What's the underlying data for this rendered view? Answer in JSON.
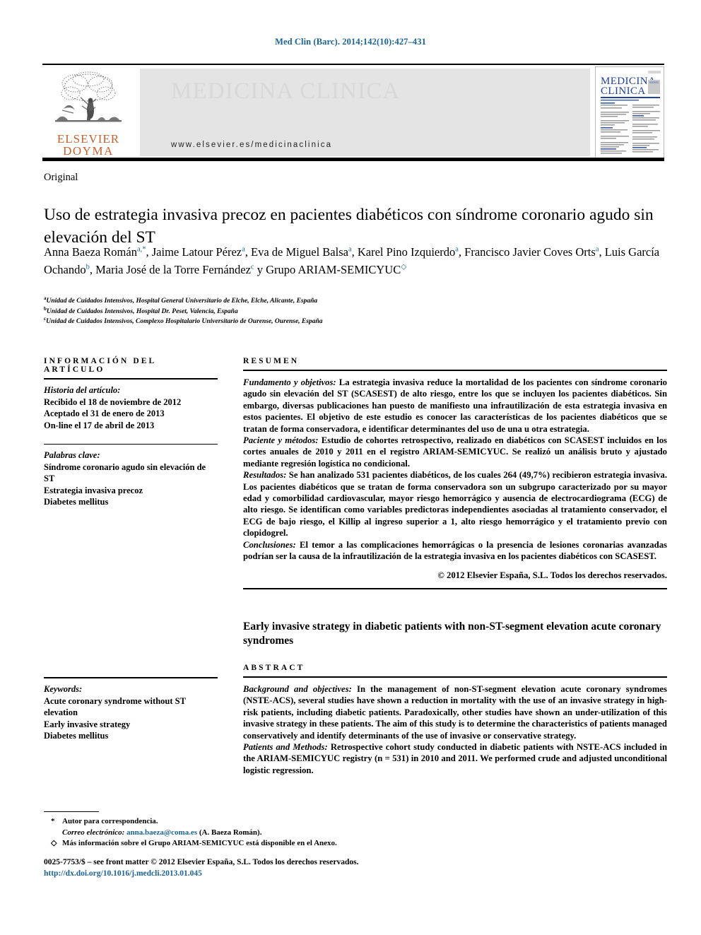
{
  "running_head": "Med Clin (Barc). 2014;142(10):427–431",
  "masthead": {
    "publisher_line1": "ELSEVIER",
    "publisher_line2": "DOYMA",
    "journal_title": "MEDICINA CLINICA",
    "journal_url": "www.elsevier.es/medicinaclinica",
    "cover_title_line1": "MEDICINA",
    "cover_title_line2": "CLINICA"
  },
  "article": {
    "type": "Original",
    "title_es": "Uso de estrategia invasiva precoz en pacientes diabéticos con síndrome coronario agudo sin elevación del ST",
    "title_en": "Early invasive strategy in diabetic patients with non-ST-segment elevation acute coronary syndromes"
  },
  "authors": {
    "list": [
      {
        "name": "Anna Baeza Román",
        "marks": "a,*"
      },
      {
        "name": "Jaime Latour Pérez",
        "marks": "a"
      },
      {
        "name": "Eva de Miguel Balsa",
        "marks": "a"
      },
      {
        "name": "Karel Pino Izquierdo",
        "marks": "a"
      },
      {
        "name": "Francisco Javier Coves Orts",
        "marks": "a"
      },
      {
        "name": "Luis García Ochando",
        "marks": "b"
      },
      {
        "name": "Maria José de la Torre Fernández",
        "marks": "c"
      },
      {
        "name": "Grupo ARIAM-SEMICYUC",
        "marks": "◇"
      }
    ],
    "conjunction": "y",
    "affiliations": [
      {
        "mark": "a",
        "text": "Unidad de Cuidados Intensivos, Hospital General Universitario de Elche, Elche, Alicante, España"
      },
      {
        "mark": "b",
        "text": "Unidad de Cuidados Intensivos, Hospital Dr. Peset, Valencia, España"
      },
      {
        "mark": "c",
        "text": "Unidad de Cuidados Intensivos, Complexo Hospitalario Universitario de Ourense, Ourense, España"
      }
    ]
  },
  "info_section": {
    "heading": "INFORMACIÓN DEL ARTÍCULO",
    "history_label": "Historia del artículo:",
    "history": [
      "Recibido el 18 de noviembre de 2012",
      "Aceptado el 31 de enero de 2013",
      "On-line el 17 de abril de 2013"
    ],
    "history_italic_prefix": "On-line",
    "keywords_label": "Palabras clave:",
    "keywords": [
      "Síndrome coronario agudo sin elevación de ST",
      "Estrategia invasiva precoz",
      "Diabetes mellitus"
    ]
  },
  "keywords_en": {
    "label": "Keywords:",
    "items": [
      "Acute coronary syndrome without ST elevation",
      "Early invasive strategy",
      "Diabetes mellitus"
    ]
  },
  "resumen": {
    "heading": "RESUMEN",
    "paragraphs": [
      {
        "lead": "Fundamento y objetivos:",
        "text": " La estrategia invasiva reduce la mortalidad de los pacientes con síndrome coronario agudo sin elevación del ST (SCASEST) de alto riesgo, entre los que se incluyen los pacientes diabéticos. Sin embargo, diversas publicaciones han puesto de manifiesto una infrautilización de esta estrategia invasiva en estos pacientes. El objetivo de este estudio es conocer las características de los pacientes diabéticos que se tratan de forma conservadora, e identificar determinantes del uso de una u otra estrategia."
      },
      {
        "lead": "Paciente y métodos:",
        "text": " Estudio de cohortes retrospectivo, realizado en diabéticos con SCASEST incluidos en los cortes anuales de 2010 y 2011 en el registro ARIAM-SEMICYUC. Se realizó un análisis bruto y ajustado mediante regresión logística no condicional."
      },
      {
        "lead": "Resultados:",
        "text": " Se han analizado 531 pacientes diabéticos, de los cuales 264 (49,7%) recibieron estrategia invasiva. Los pacientes diabéticos que se tratan de forma conservadora son un subgrupo caracterizado por su mayor edad y comorbilidad cardiovascular, mayor riesgo hemorrágico y ausencia de electrocardiograma (ECG) de alto riesgo. Se identifican como variables predictoras independientes asociadas al tratamiento conservador, el ECG de bajo riesgo, el Killip al ingreso superior a 1, alto riesgo hemorrágico y el tratamiento previo con clopidogrel."
      },
      {
        "lead": "Conclusiones:",
        "text": " El temor a las complicaciones hemorrágicas o la presencia de lesiones coronarias avanzadas podrían ser la causa de la infrautilización de la estrategia invasiva en los pacientes diabéticos con SCASEST."
      }
    ],
    "copyright": "© 2012 Elsevier España, S.L. Todos los derechos reservados."
  },
  "abstract": {
    "heading": "ABSTRACT",
    "paragraphs": [
      {
        "lead": "Background and objectives:",
        "text": " In the management of non-ST-segment elevation acute coronary syndromes (NSTE-ACS), several studies have shown a reduction in mortality with the use of an invasive strategy in high-risk patients, including diabetic patients. Paradoxically, other studies have shown an under-utilization of this invasive strategy in these patients. The aim of this study is to determine the characteristics of patients managed conservatively and identify determinants of the use of invasive or conservative strategy."
      },
      {
        "lead": "Patients and Methods:",
        "text": " Retrospective cohort study conducted in diabetic patients with NSTE-ACS included in the ARIAM-SEMICYUC registry (n = 531) in 2010 and 2011. We performed crude and adjusted unconditional logistic regression."
      }
    ]
  },
  "footnotes": {
    "corresponding_mark": "*",
    "corresponding_text": "Autor para correspondencia.",
    "email_label": "Correo electrónico:",
    "email": "anna.baeza@coma.es",
    "email_suffix": "(A. Baeza Román).",
    "group_mark": "◇",
    "group_text": "Más información sobre el Grupo ARIAM-SEMICYUC está disponible en el Anexo."
  },
  "bottom": {
    "issn_line": "0025-7753/$ – see front matter © 2012 Elsevier España, S.L. Todos los derechos reservados.",
    "doi": "http://dx.doi.org/10.1016/j.medcli.2013.01.045"
  },
  "colors": {
    "link_blue": "#1a6496",
    "elsevier_orange": "#c4622d",
    "banner_gray": "#e4e4e4",
    "banner_title_gray": "#d8d8d8"
  }
}
